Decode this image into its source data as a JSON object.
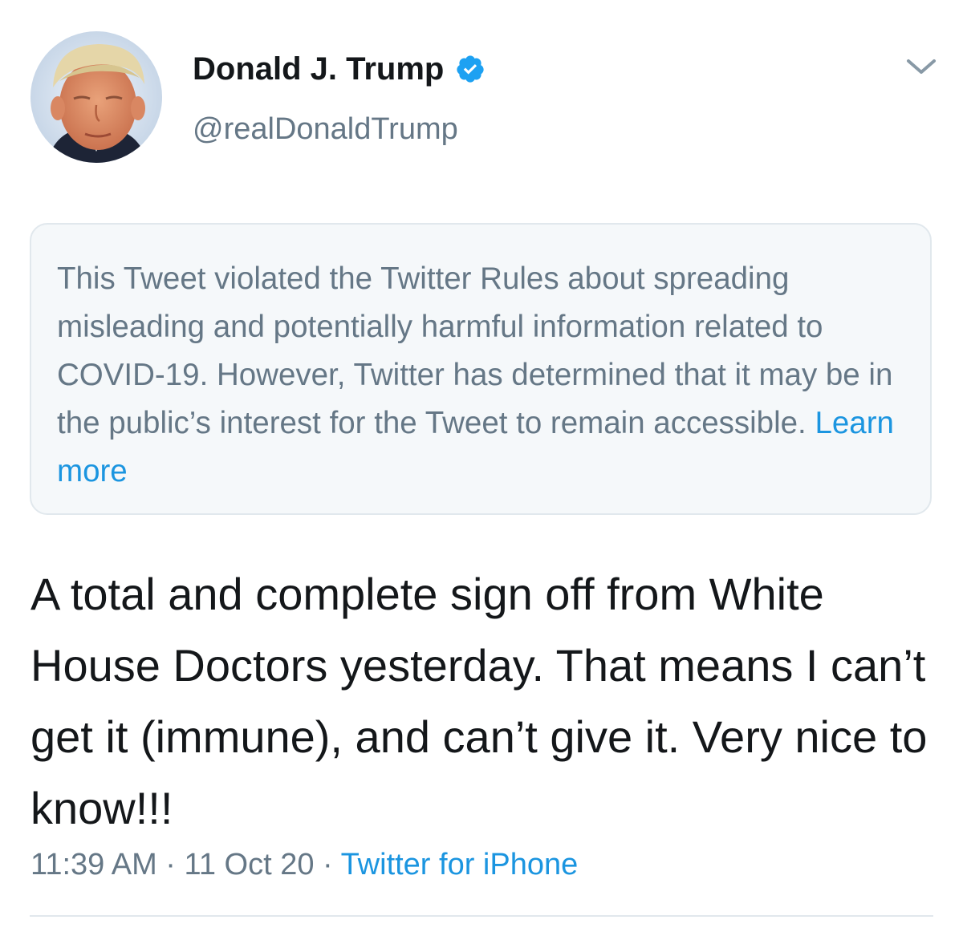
{
  "author": {
    "display_name": "Donald J. Trump",
    "handle": "@realDonaldTrump",
    "verified_icon": "verified-badge-icon",
    "avatar_icon": "profile-photo"
  },
  "menu": {
    "icon": "chevron-down-icon"
  },
  "notice": {
    "text": "This Tweet violated the Twitter Rules about spreading misleading and potentially harmful information related to COVID-19. However, Twitter has determined that it may be in the public’s interest for the Tweet to remain accessible.",
    "link_label": "Learn more"
  },
  "tweet": {
    "text": "A total and complete sign off from White House Doctors yesterday. That means I can’t get it (immune), and can’t give it. Very nice to know!!!",
    "time": "11:39 AM",
    "separator": "·",
    "date": "11 Oct 20",
    "source": "Twitter for iPhone"
  },
  "colors": {
    "text_primary": "#14171a",
    "text_secondary": "#657786",
    "link": "#1b95e0",
    "notice_bg": "#f5f8fa",
    "border": "#e1e8ed",
    "verified": "#1da1f2"
  }
}
